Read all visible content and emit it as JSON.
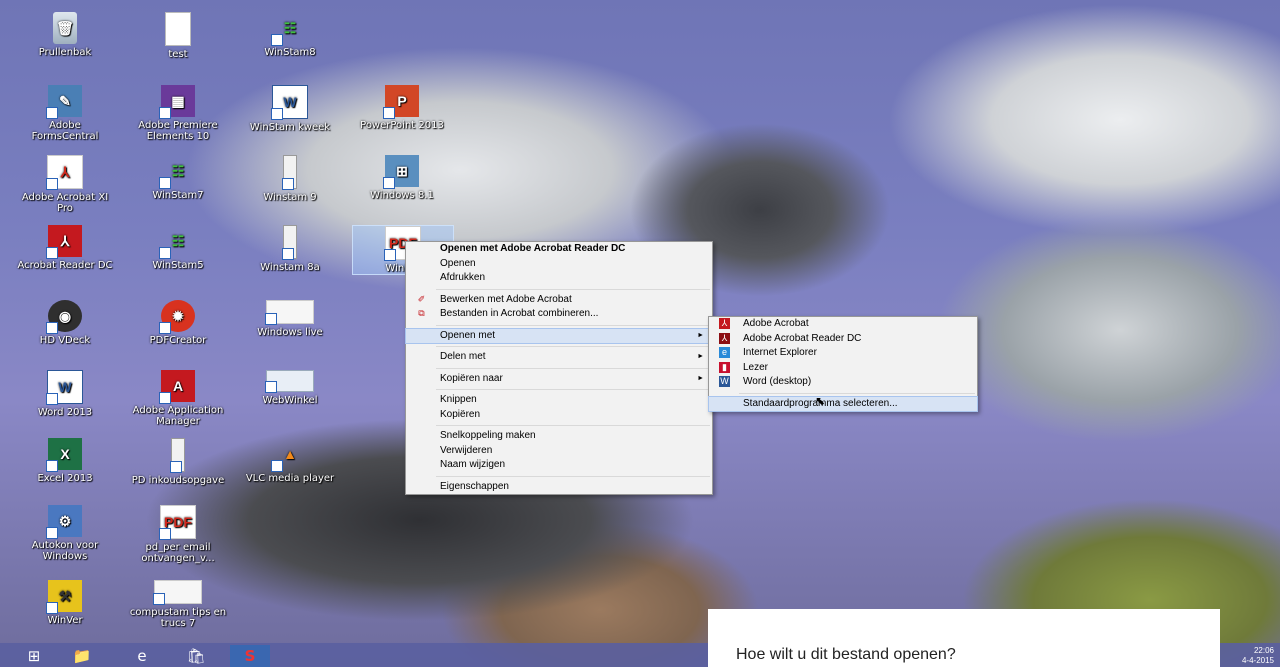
{
  "desktop_icons": [
    {
      "name": "recycle-bin-icon",
      "label": "Prullenbak",
      "kind": "trash",
      "glyph": "🗑"
    },
    {
      "name": "test-doc-icon",
      "label": "test",
      "kind": "doc",
      "glyph": ""
    },
    {
      "name": "winstam8-icon",
      "label": "WinStam8",
      "kind": "tree",
      "glyph": "☷"
    },
    {
      "name": "adobe-forms-central-icon",
      "label": "Adobe FormsCentral",
      "kind": "forms",
      "glyph": "✎"
    },
    {
      "name": "adobe-premiere-icon",
      "label": "Adobe Premiere Elements 10",
      "kind": "prem",
      "glyph": "▦"
    },
    {
      "name": "winstam-kweek-icon",
      "label": "WinStam kweek",
      "kind": "word",
      "glyph": "W"
    },
    {
      "name": "powerpoint-icon",
      "label": "PowerPoint 2013",
      "kind": "ppt",
      "glyph": "P"
    },
    {
      "name": "adobe-acrobat-xi-icon",
      "label": "Adobe Acrobat XI Pro",
      "kind": "pdf",
      "glyph": "⅄"
    },
    {
      "name": "winstam7-icon",
      "label": "WinStam7",
      "kind": "tree",
      "glyph": "☷"
    },
    {
      "name": "winstam9-icon",
      "label": "Winstam 9",
      "kind": "bar",
      "glyph": ""
    },
    {
      "name": "windows81-icon",
      "label": "Windows 8.1",
      "kind": "win",
      "glyph": "⊞"
    },
    {
      "name": "acrobat-reader-dc-icon",
      "label": "Acrobat Reader DC",
      "kind": "acro",
      "glyph": "⅄"
    },
    {
      "name": "winstam5-icon",
      "label": "WinStam5",
      "kind": "tree",
      "glyph": "☷"
    },
    {
      "name": "winstam8a-icon",
      "label": "Winstam 8a",
      "kind": "bar",
      "glyph": ""
    },
    {
      "name": "winstam-pdf-icon",
      "label": "WinSta",
      "kind": "pdf",
      "glyph": "PDF"
    },
    {
      "name": "hd-vdeck-icon",
      "label": "HD VDeck",
      "kind": "hd",
      "glyph": "◉"
    },
    {
      "name": "pdfcreator-icon",
      "label": "PDFCreator",
      "kind": "pdfc",
      "glyph": "✹"
    },
    {
      "name": "windows-live-icon",
      "label": "Windows live",
      "kind": "winlive",
      "glyph": ""
    },
    {
      "name": "word2013-icon",
      "label": "Word 2013",
      "kind": "word",
      "glyph": "W"
    },
    {
      "name": "adobe-app-manager-icon",
      "label": "Adobe Application Manager",
      "kind": "adobeapp",
      "glyph": "A"
    },
    {
      "name": "webwinkel-icon",
      "label": "WebWinkel",
      "kind": "shop",
      "glyph": ""
    },
    {
      "name": "excel2013-icon",
      "label": "Excel 2013",
      "kind": "excel",
      "glyph": "X"
    },
    {
      "name": "pd-inkoudsopgave-icon",
      "label": "PD inkoudsopgave",
      "kind": "bar",
      "glyph": ""
    },
    {
      "name": "vlc-icon",
      "label": "VLC media player",
      "kind": "vlc",
      "glyph": "▲"
    },
    {
      "name": "autokon-icon",
      "label": "Autokon voor Windows",
      "kind": "auto",
      "glyph": "⚙"
    },
    {
      "name": "pd-per-email-icon",
      "label": "pd_per email ontvangen_v...",
      "kind": "pdf",
      "glyph": "PDF"
    },
    {
      "name": "winver-icon",
      "label": "WinVer",
      "kind": "winver",
      "glyph": "⚒"
    },
    {
      "name": "compustam-tips-icon",
      "label": "compustam tips en trucs 7",
      "kind": "cstips",
      "glyph": ""
    }
  ],
  "context_menu": {
    "items": [
      {
        "label": "Openen met Adobe Acrobat Reader DC",
        "bold": true
      },
      {
        "label": "Openen"
      },
      {
        "label": "Afdrukken"
      },
      {
        "sep": true
      },
      {
        "label": "Bewerken met Adobe Acrobat",
        "icon": "✐"
      },
      {
        "label": "Bestanden in Acrobat combineren...",
        "icon": "⧉"
      },
      {
        "sep": true
      },
      {
        "label": "Openen met",
        "submenu": true,
        "highlight": true
      },
      {
        "sep": true
      },
      {
        "label": "Delen met",
        "submenu": true
      },
      {
        "sep": true
      },
      {
        "label": "Kopiëren naar",
        "submenu": true
      },
      {
        "sep": true
      },
      {
        "label": "Knippen"
      },
      {
        "label": "Kopiëren"
      },
      {
        "sep": true
      },
      {
        "label": "Snelkoppeling maken"
      },
      {
        "label": "Verwijderen"
      },
      {
        "label": "Naam wijzigen"
      },
      {
        "sep": true
      },
      {
        "label": "Eigenschappen"
      }
    ]
  },
  "submenu": {
    "items": [
      {
        "label": "Adobe Acrobat",
        "icon": "⅄",
        "color": "#c4191f"
      },
      {
        "label": "Adobe Acrobat Reader DC",
        "icon": "⅄",
        "color": "#8b0e13"
      },
      {
        "label": "Internet Explorer",
        "icon": "e",
        "color": "#2a8ad8"
      },
      {
        "label": "Lezer",
        "icon": "▮",
        "color": "#c8102e"
      },
      {
        "label": "Word (desktop)",
        "icon": "W",
        "color": "#2b5797"
      },
      {
        "sep": true
      },
      {
        "label": "Standaardprogramma selecteren...",
        "highlight": true
      }
    ]
  },
  "dialog": {
    "title": "Hoe wilt u dit bestand openen?"
  },
  "taskbar": {
    "buttons": [
      {
        "name": "start-button-icon",
        "glyph": "⊞"
      },
      {
        "name": "file-explorer-icon",
        "glyph": "📁"
      },
      {
        "name": "internet-explorer-icon",
        "glyph": "e"
      },
      {
        "name": "store-icon",
        "glyph": "🛍"
      },
      {
        "name": "winstam-taskbar-icon",
        "glyph": "S"
      }
    ],
    "time": "22:06",
    "date": "4-4-2015"
  },
  "colors": {
    "accent": "#d7e3f4",
    "taskbar": "#5a5fa0"
  }
}
